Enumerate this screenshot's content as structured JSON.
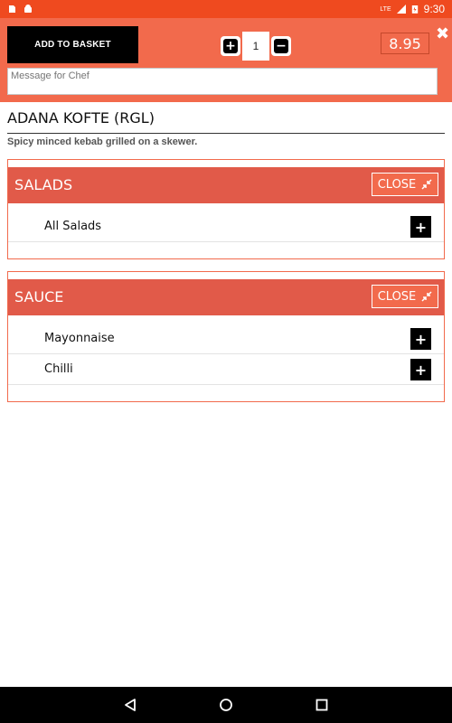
{
  "status_bar": {
    "time": "9:30",
    "network": "LTE",
    "icons": [
      "sim-icon",
      "android-icon",
      "signal-icon",
      "battery-icon"
    ]
  },
  "header": {
    "add_to_basket_label": "ADD TO BASKET",
    "quantity": "1",
    "increment_glyph": "+",
    "decrement_glyph": "−",
    "price": "8.95",
    "close_glyph": "✖",
    "chef_message_placeholder": "Message for Chef"
  },
  "dish": {
    "title": "ADANA KOFTE (RGL)",
    "description": "Spicy minced kebab grilled on a skewer."
  },
  "groups": [
    {
      "title": "SALADS",
      "close_label": "CLOSE",
      "options": [
        {
          "label": "All Salads"
        }
      ]
    },
    {
      "title": "SAUCE",
      "close_label": "CLOSE",
      "options": [
        {
          "label": "Mayonnaise"
        },
        {
          "label": "Chilli"
        }
      ]
    }
  ],
  "colors": {
    "status_bar": "#ef4a1f",
    "header": "#f26a4c",
    "group_header": "#e15a49",
    "black": "#000000"
  },
  "nav_bar": {
    "buttons": [
      "back-icon",
      "home-icon",
      "recents-icon"
    ]
  }
}
